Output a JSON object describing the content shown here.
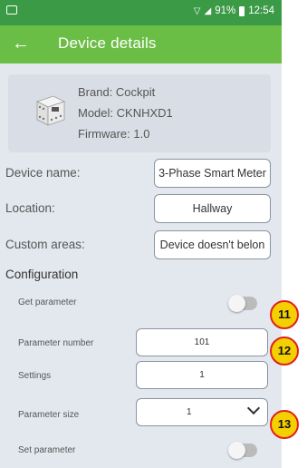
{
  "status_bar": {
    "battery": "91%",
    "time": "12:54"
  },
  "app_bar": {
    "title": "Device details",
    "back_icon": "arrow-left-icon"
  },
  "device": {
    "brand_line": "Brand: Cockpit",
    "model_line": "Model: CKNHXD1",
    "firmware_line": "Firmware: 1.0"
  },
  "fields": {
    "name_label": "Device name:",
    "name_value": "3-Phase Smart Meter",
    "location_label": "Location:",
    "location_value": "Hallway",
    "areas_label": "Custom areas:",
    "areas_value": "Device doesn't belon"
  },
  "configuration": {
    "heading": "Configuration",
    "get_parameter_label": "Get parameter",
    "get_parameter_on": false,
    "parameter_number_label": "Parameter number",
    "parameter_number_value": "101",
    "settings_label": "Settings",
    "settings_value": "1",
    "parameter_size_label": "Parameter size",
    "parameter_size_value": "1",
    "set_parameter_label": "Set parameter",
    "set_parameter_on": false
  },
  "badges": {
    "b11": "11",
    "b12": "12",
    "b13": "13"
  },
  "colors": {
    "status_bar": "#3a9a46",
    "app_bar": "#6bbe45",
    "background": "#e3e8ef",
    "badge_fill": "#f5d000",
    "badge_border": "#e02020"
  }
}
